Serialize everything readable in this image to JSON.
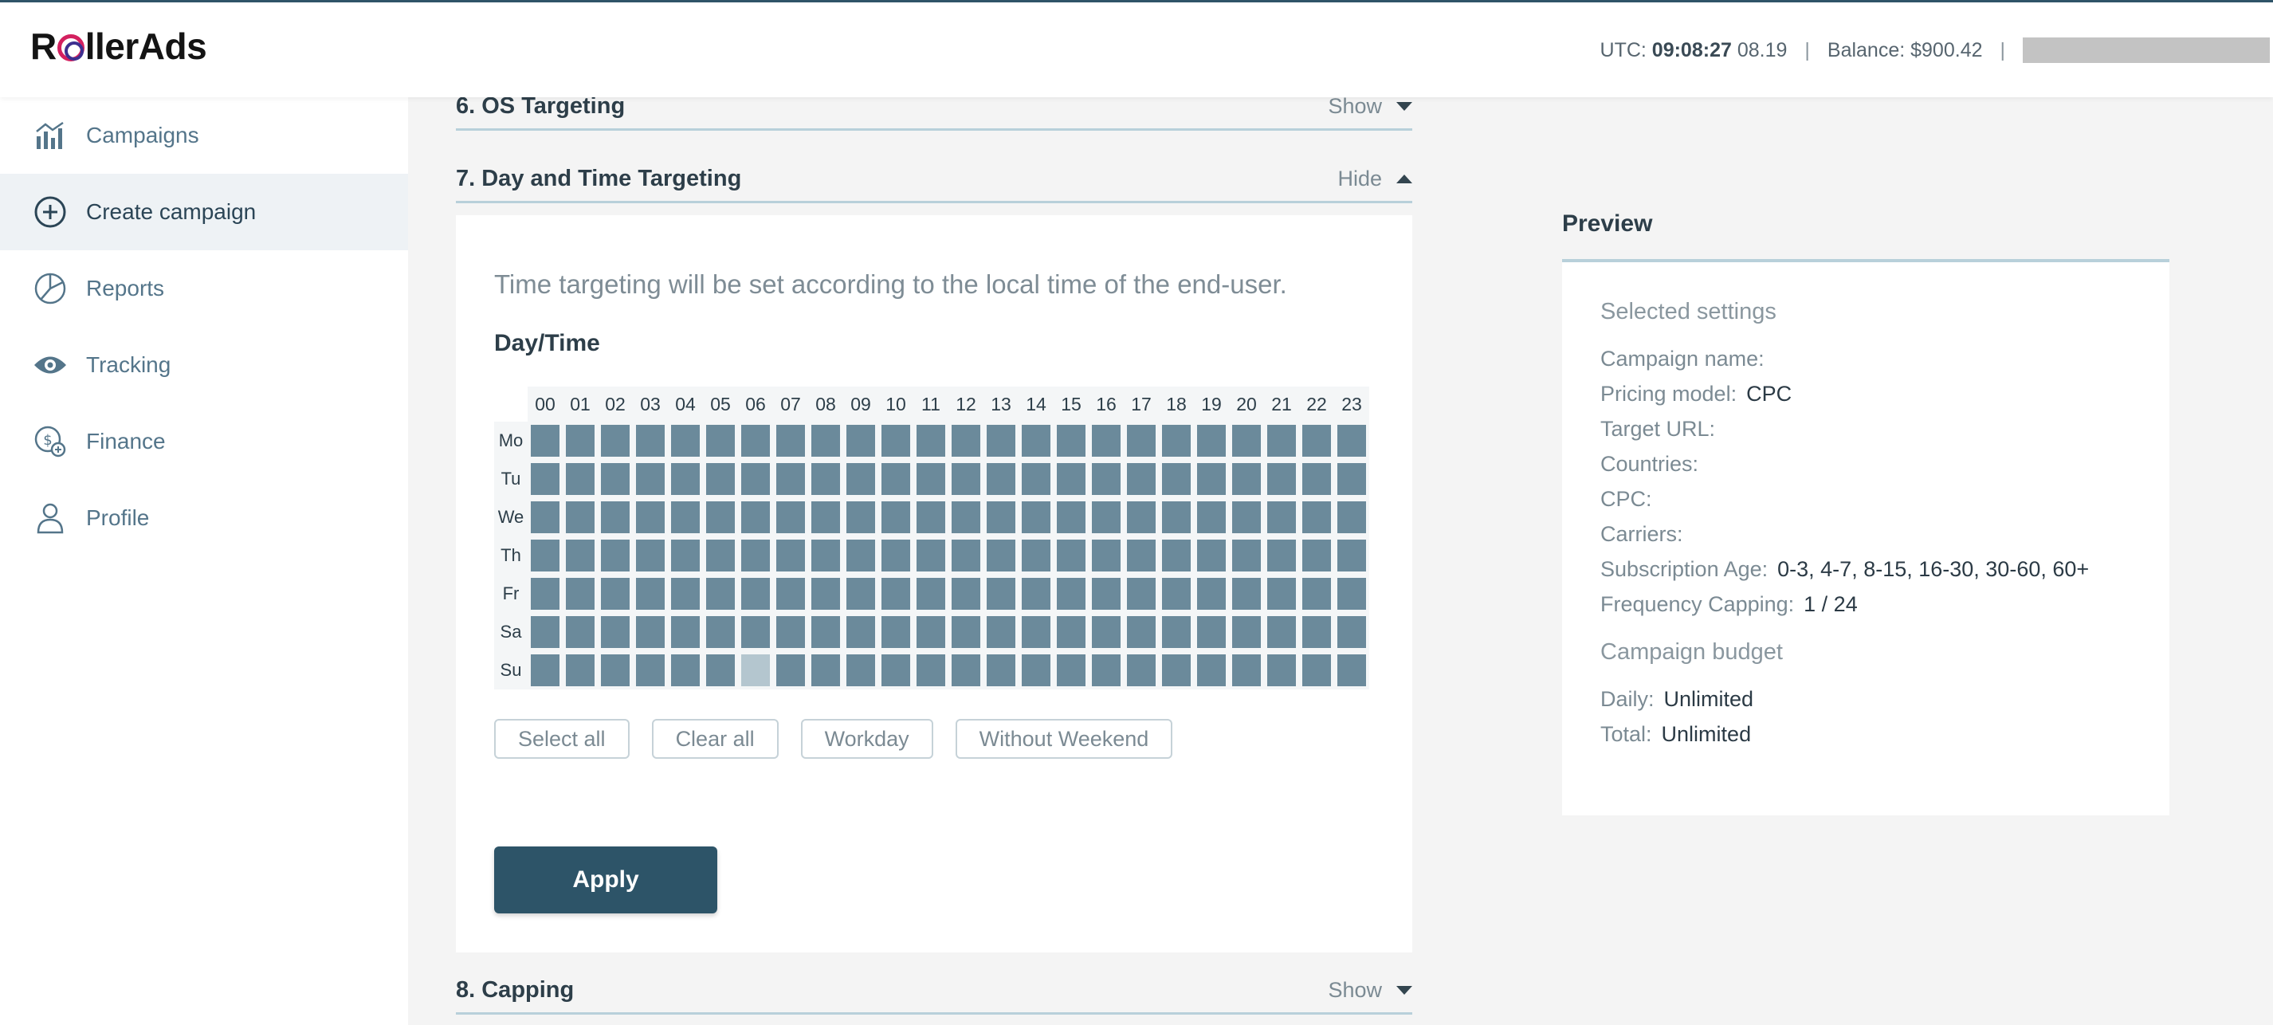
{
  "header": {
    "logo": {
      "part1": "R",
      "part2": "llerAds"
    },
    "utc_label": "UTC:",
    "utc_time": "09:08:27",
    "utc_date": "08.19",
    "balance": "Balance: $900.42",
    "separator": "|"
  },
  "sidebar": {
    "items": [
      {
        "label": "Campaigns",
        "icon": "chart-icon"
      },
      {
        "label": "Create campaign",
        "icon": "plus-circle-icon"
      },
      {
        "label": "Reports",
        "icon": "pie-chart-icon"
      },
      {
        "label": "Tracking",
        "icon": "eye-icon"
      },
      {
        "label": "Finance",
        "icon": "dollar-coin-icon"
      },
      {
        "label": "Profile",
        "icon": "user-icon"
      }
    ],
    "active_index": 1
  },
  "sections": {
    "os": {
      "title": "6. OS Targeting",
      "toggle": "Show"
    },
    "daytime": {
      "title": "7. Day and Time Targeting",
      "toggle": "Hide"
    },
    "capping": {
      "title": "8. Capping",
      "toggle": "Show"
    }
  },
  "daytime_panel": {
    "note": "Time targeting will be set according to the local time of the end-user.",
    "grid_title": "Day/Time",
    "hours": [
      "00",
      "01",
      "02",
      "03",
      "04",
      "05",
      "06",
      "07",
      "08",
      "09",
      "10",
      "11",
      "12",
      "13",
      "14",
      "15",
      "16",
      "17",
      "18",
      "19",
      "20",
      "21",
      "22",
      "23"
    ],
    "days": [
      "Mo",
      "Tu",
      "We",
      "Th",
      "Fr",
      "Sa",
      "Su"
    ],
    "unselected": [
      [
        6,
        6
      ]
    ],
    "buttons": {
      "select_all": "Select all",
      "clear_all": "Clear all",
      "workday": "Workday",
      "without_weekend": "Without Weekend"
    },
    "apply": "Apply"
  },
  "preview": {
    "title": "Preview",
    "selected_heading": "Selected settings",
    "rows": [
      {
        "label": "Campaign name:",
        "value": ""
      },
      {
        "label": "Pricing model:",
        "value": "CPC"
      },
      {
        "label": "Target URL:",
        "value": ""
      },
      {
        "label": "Countries:",
        "value": ""
      },
      {
        "label": "CPC:",
        "value": ""
      },
      {
        "label": "Carriers:",
        "value": ""
      },
      {
        "label": "Subscription Age:",
        "value": "0-3, 4-7, 8-15, 16-30, 30-60, 60+"
      },
      {
        "label": "Frequency Capping:",
        "value": "1 / 24"
      }
    ],
    "budget_heading": "Campaign budget",
    "budget_rows": [
      {
        "label": "Daily:",
        "value": "Unlimited"
      },
      {
        "label": "Total:",
        "value": "Unlimited"
      }
    ]
  }
}
